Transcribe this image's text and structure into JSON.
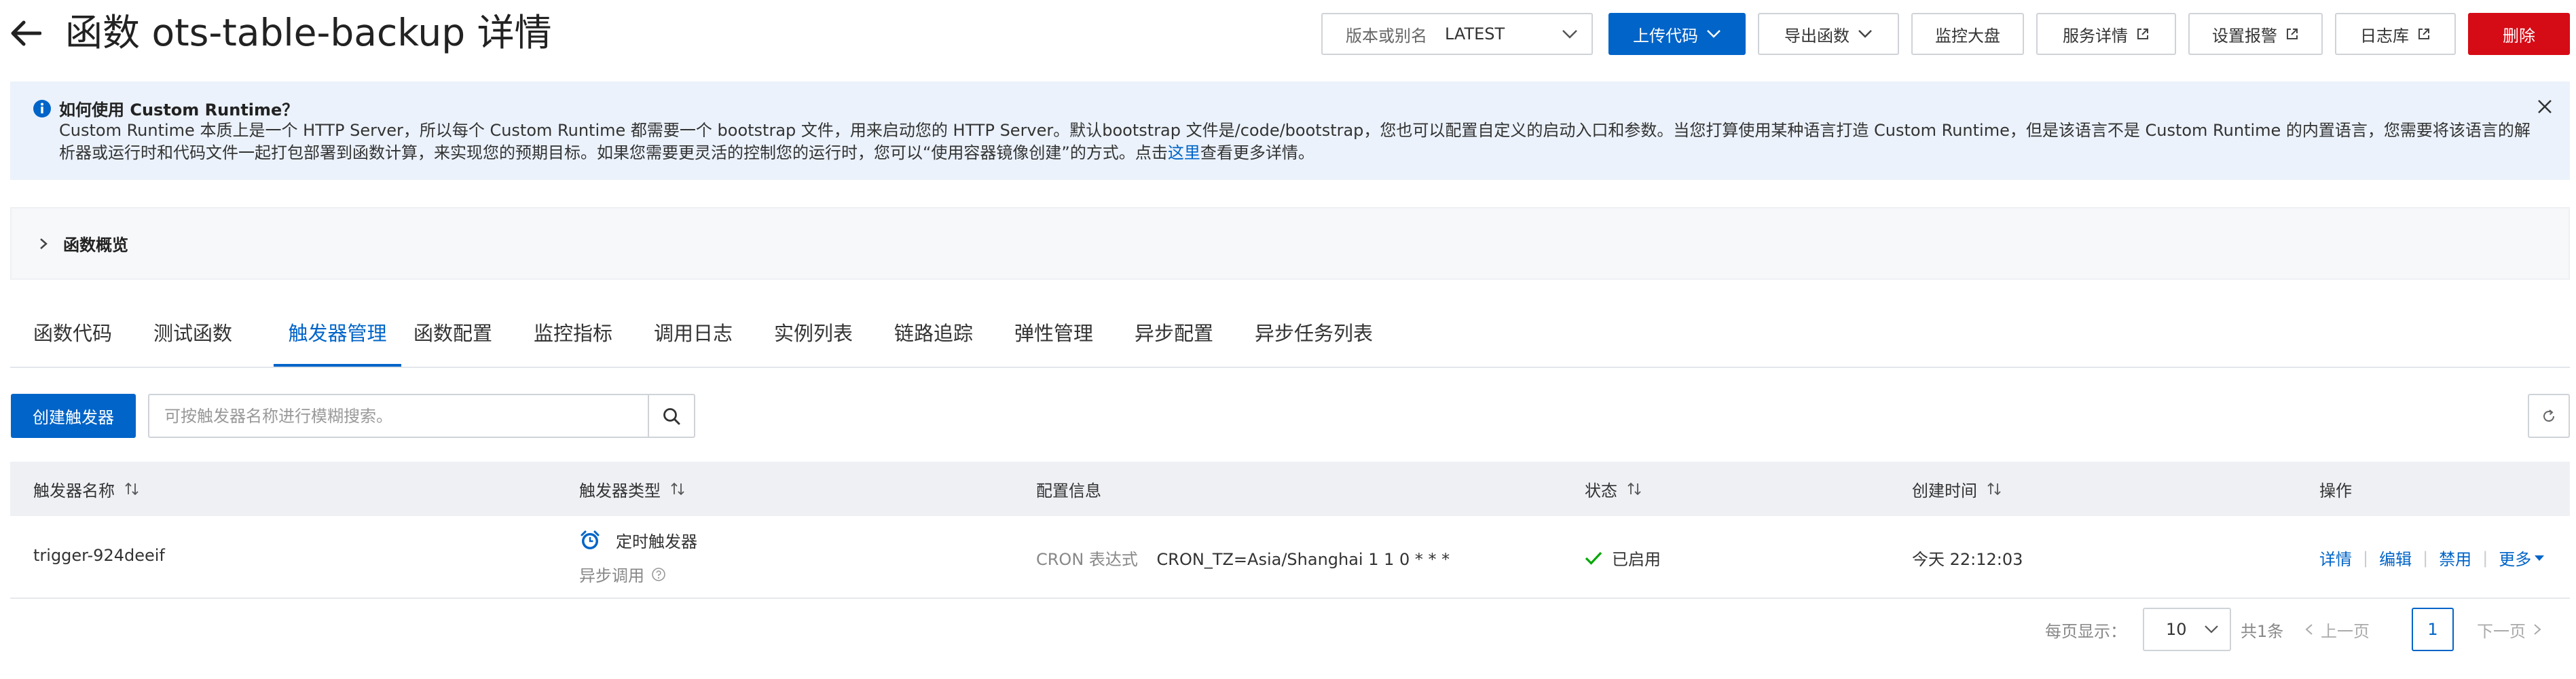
{
  "header": {
    "title": "函数 ots-table-backup 详情",
    "version": {
      "label": "版本或别名",
      "value": "LATEST"
    },
    "buttons": {
      "upload": "上传代码",
      "export": "导出函数",
      "monitor": "监控大盘",
      "service_detail": "服务详情",
      "alert": "设置报警",
      "logstore": "日志库",
      "delete": "删除"
    }
  },
  "notice": {
    "title": "如何使用 Custom Runtime？",
    "text_before": "Custom Runtime 本质上是一个 HTTP Server，所以每个 Custom Runtime 都需要一个 bootstrap 文件，用来启动您的 HTTP Server。默认bootstrap 文件是/code/bootstrap，您也可以配置自定义的启动入口和参数。当您打算使用某种语言打造 Custom Runtime，但是该语言不是 Custom Runtime 的内置语言，您需要将该语言的解析器或运行时和代码文件一起打包部署到函数计算，来实现您的预期目标。如果您需要更灵活的控制您的运行时，您可以“使用容器镜像创建”的方式。点击",
    "link": "这里",
    "text_after": "查看更多详情。"
  },
  "overview": {
    "title": "函数概览"
  },
  "tabs": [
    "函数代码",
    "测试函数",
    "触发器管理",
    "函数配置",
    "监控指标",
    "调用日志",
    "实例列表",
    "链路追踪",
    "弹性管理",
    "异步配置",
    "异步任务列表"
  ],
  "active_tab": "触发器管理",
  "toolbar": {
    "create": "创建触发器",
    "search_placeholder": "可按触发器名称进行模糊搜索。"
  },
  "table": {
    "columns": {
      "name": "触发器名称",
      "type": "触发器类型",
      "config": "配置信息",
      "status": "状态",
      "created": "创建时间",
      "actions": "操作"
    },
    "rows": [
      {
        "name": "trigger-924deeif",
        "type": "定时触发器",
        "invoke": "异步调用",
        "config_label": "CRON 表达式",
        "config_value": "CRON_TZ=Asia/Shanghai 1 1 0 * * *",
        "status": "已启用",
        "created": "今天 22:12:03",
        "actions": {
          "detail": "详情",
          "edit": "编辑",
          "disable": "禁用",
          "more": "更多"
        }
      }
    ]
  },
  "pagination": {
    "page_size_label": "每页显示：",
    "page_size": "10",
    "total": "共1条",
    "prev": "上一页",
    "current": "1",
    "next": "下一页"
  },
  "colors": {
    "primary": "#0064c8",
    "danger": "#d50b16",
    "success": "#00a700",
    "notice_bg": "#ebf2fb"
  }
}
